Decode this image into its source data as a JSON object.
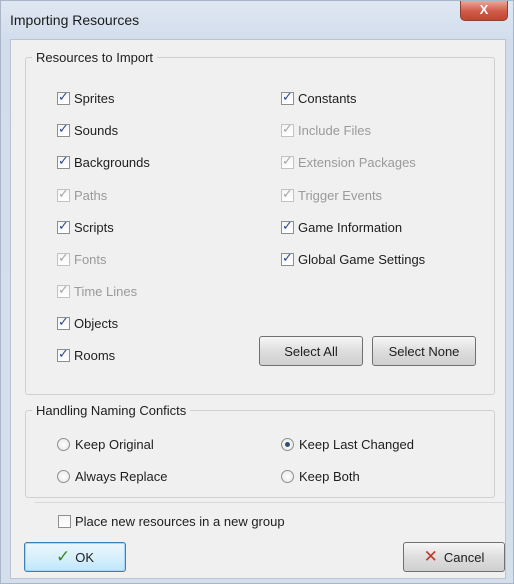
{
  "window": {
    "title": "Importing Resources",
    "close_glyph": "X"
  },
  "resources_group": {
    "title": "Resources to Import",
    "left_items": [
      {
        "label": "Sprites",
        "checked": true,
        "enabled": true
      },
      {
        "label": "Sounds",
        "checked": true,
        "enabled": true
      },
      {
        "label": "Backgrounds",
        "checked": true,
        "enabled": true
      },
      {
        "label": "Paths",
        "checked": true,
        "enabled": false
      },
      {
        "label": "Scripts",
        "checked": true,
        "enabled": true
      },
      {
        "label": "Fonts",
        "checked": true,
        "enabled": false
      },
      {
        "label": "Time Lines",
        "checked": true,
        "enabled": false
      },
      {
        "label": "Objects",
        "checked": true,
        "enabled": true
      },
      {
        "label": "Rooms",
        "checked": true,
        "enabled": true
      }
    ],
    "right_items": [
      {
        "label": "Constants",
        "checked": true,
        "enabled": true
      },
      {
        "label": "Include Files",
        "checked": true,
        "enabled": false
      },
      {
        "label": "Extension Packages",
        "checked": true,
        "enabled": false
      },
      {
        "label": "Trigger Events",
        "checked": true,
        "enabled": false
      },
      {
        "label": "Game Information",
        "checked": true,
        "enabled": true
      },
      {
        "label": "Global Game Settings",
        "checked": true,
        "enabled": true
      }
    ],
    "select_all_label": "Select All",
    "select_none_label": "Select None"
  },
  "naming_group": {
    "title": "Handling Naming Conficts",
    "options": [
      {
        "label": "Keep Original",
        "selected": false
      },
      {
        "label": "Keep Last Changed",
        "selected": true
      },
      {
        "label": "Always Replace",
        "selected": false
      },
      {
        "label": "Keep Both",
        "selected": false
      }
    ]
  },
  "new_group_checkbox": {
    "label": "Place new resources in a new group",
    "checked": false
  },
  "footer": {
    "ok_label": "OK",
    "cancel_label": "Cancel"
  },
  "icons": {
    "check_glyph": "✓",
    "ok_icon": "check-icon",
    "cancel_icon": "x-icon"
  },
  "colors": {
    "accent": "#3c7fb1",
    "ok_green": "#3a8a24",
    "cancel_red": "#c2382a",
    "close_red": "#cf5a47"
  }
}
